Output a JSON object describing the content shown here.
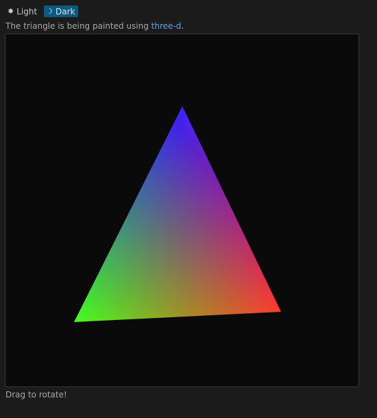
{
  "theme": {
    "light": {
      "label": "Light",
      "icon": "sun-icon",
      "glyph": "✹"
    },
    "dark": {
      "label": "Dark",
      "icon": "moon-icon",
      "glyph": "☽",
      "selected": true
    },
    "active_color": "#0b5a80"
  },
  "description": {
    "prefix": "The triangle is being painted using ",
    "link": "three-d",
    "suffix": "."
  },
  "viewport": {
    "background": "#0a0a0b",
    "vertex_colors": [
      "#2020ff",
      "#ff2020",
      "#20ff20"
    ]
  },
  "hint": "Drag to rotate!",
  "colors": {
    "page_background": "#1b1b1b",
    "link": "#5aa8e6"
  }
}
